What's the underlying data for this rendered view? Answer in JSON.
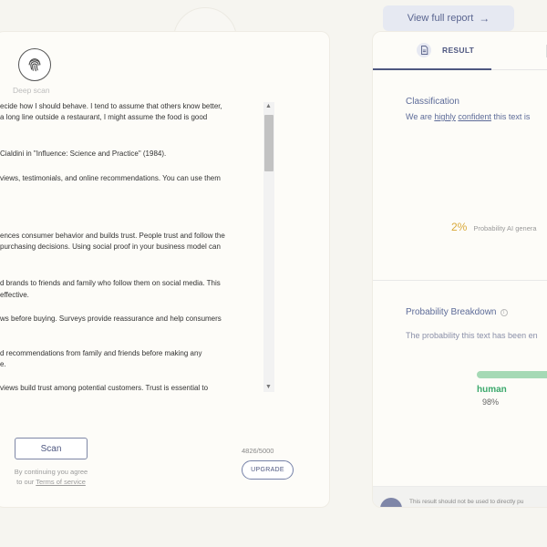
{
  "header": {
    "view_report_label": "View full report",
    "view_report_icon": "arrow-right-icon"
  },
  "scan_panel": {
    "deep_scan_label": "Deep scan",
    "deep_scan_icon": "fingerprint-icon",
    "text_lines": [
      "ecide how I should behave. I tend to assume that others know better,",
      " a long line outside a restaurant, I might assume the food is good",
      "",
      "Cialdini in \"Influence: Science and Practice\" (1984).",
      "",
      "views, testimonials, and online recommendations. You can use them",
      "",
      "",
      "",
      "ences consumer behavior and builds trust. People trust and follow the",
      " purchasing decisions. Using social proof in your business model can",
      "",
      "",
      "d brands to friends and family who follow them on social media. This",
      "effective.",
      "",
      "ws before buying. Surveys provide reassurance and help consumers",
      "",
      "",
      "d recommendations from family and friends before making any",
      "e.",
      "",
      "views build trust among potential customers. Trust is essential to"
    ],
    "scan_button_label": "Scan",
    "terms_prefix": "By continuing you agree",
    "terms_to": "to our ",
    "terms_link": "Terms of service",
    "char_count": "4826/5000",
    "upgrade_label": "UPGRADE"
  },
  "result_panel": {
    "tab_result_label": "RESULT",
    "tab_result_icon": "document-icon",
    "classification_title": "Classification",
    "classification_prefix": "We are ",
    "classification_highly": "highly",
    "classification_confident": "confident",
    "classification_suffix": " this text is",
    "ai_probability_value": "2%",
    "ai_probability_label": "Probability AI genera",
    "breakdown_title": "Probability Breakdown",
    "breakdown_text": "The probability this text has been en",
    "human_label": "human",
    "human_pct": "98%",
    "human_fraction": 0.98,
    "footer_text": "This result should not be used to directly pu"
  },
  "colors": {
    "accent": "#4e5780",
    "human_green": "#3aa86b",
    "ai_yellow": "#d9a93a"
  }
}
